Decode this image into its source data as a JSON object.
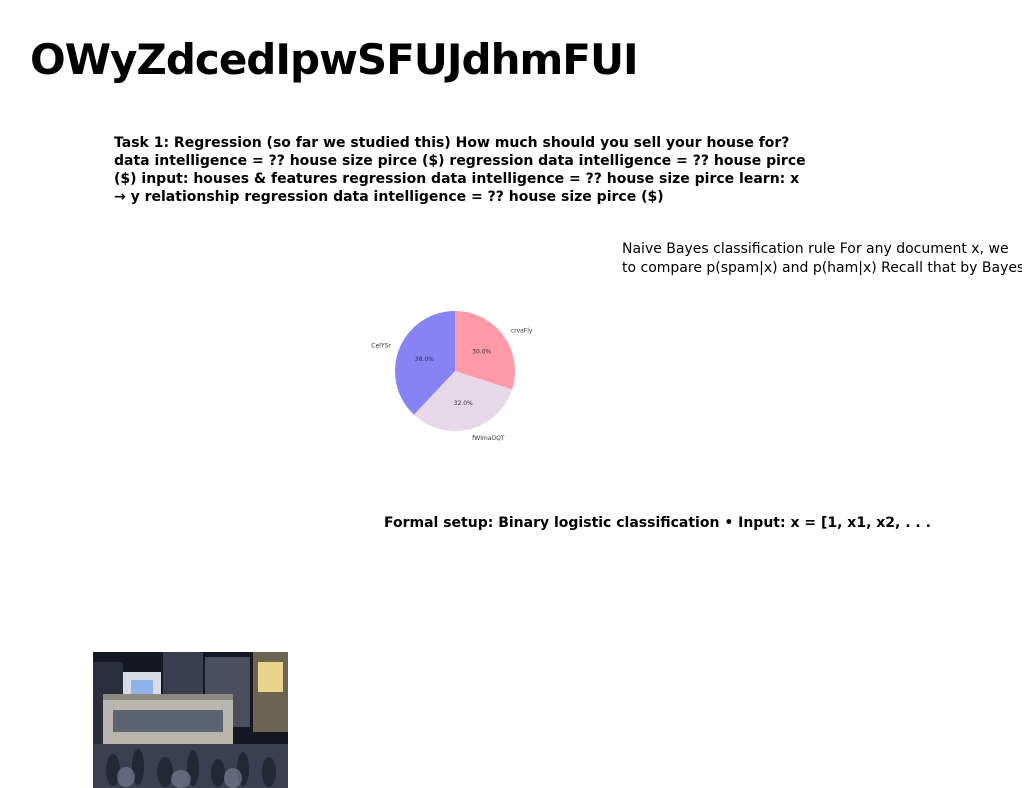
{
  "slide": {
    "title": "OWyZdcedIpwSFUJdhmFUI",
    "text_blocks": {
      "regression": "Task 1: Regression (so far we studied this) How much should you sell your house for? data intelligence = ?? house size pirce ($) regression data intelligence = ?? house pirce ($) input: houses & features regression data intelligence = ?? house size pirce learn: x → y relationship regression data intelligence = ?? house size pirce ($)",
      "naive_bayes_line1": "Naive Bayes classification rule For any document x, we",
      "naive_bayes_line2": "to compare p(spam|x) and p(ham|x) Recall that by Bayes",
      "logistic": "Formal setup: Binary logistic classification • Input: x = [1, x1, x2, . . ."
    }
  },
  "chart_data": {
    "type": "pie",
    "slices": [
      {
        "label": "crvaFly",
        "value": 30.0,
        "pct_label": "30.0%",
        "color": "#ff9aa6"
      },
      {
        "label": "fWlmaOQT",
        "value": 32.0,
        "pct_label": "32.0%",
        "color": "#e7d8e9"
      },
      {
        "label": "CeIYSr",
        "value": 38.0,
        "pct_label": "38.0%",
        "color": "#8783f5"
      }
    ]
  },
  "photo": {
    "icon": "city-street-photo",
    "colors": {
      "sky": "#151822",
      "building": "#b9b5ac",
      "crowd": "#3b4050"
    }
  }
}
